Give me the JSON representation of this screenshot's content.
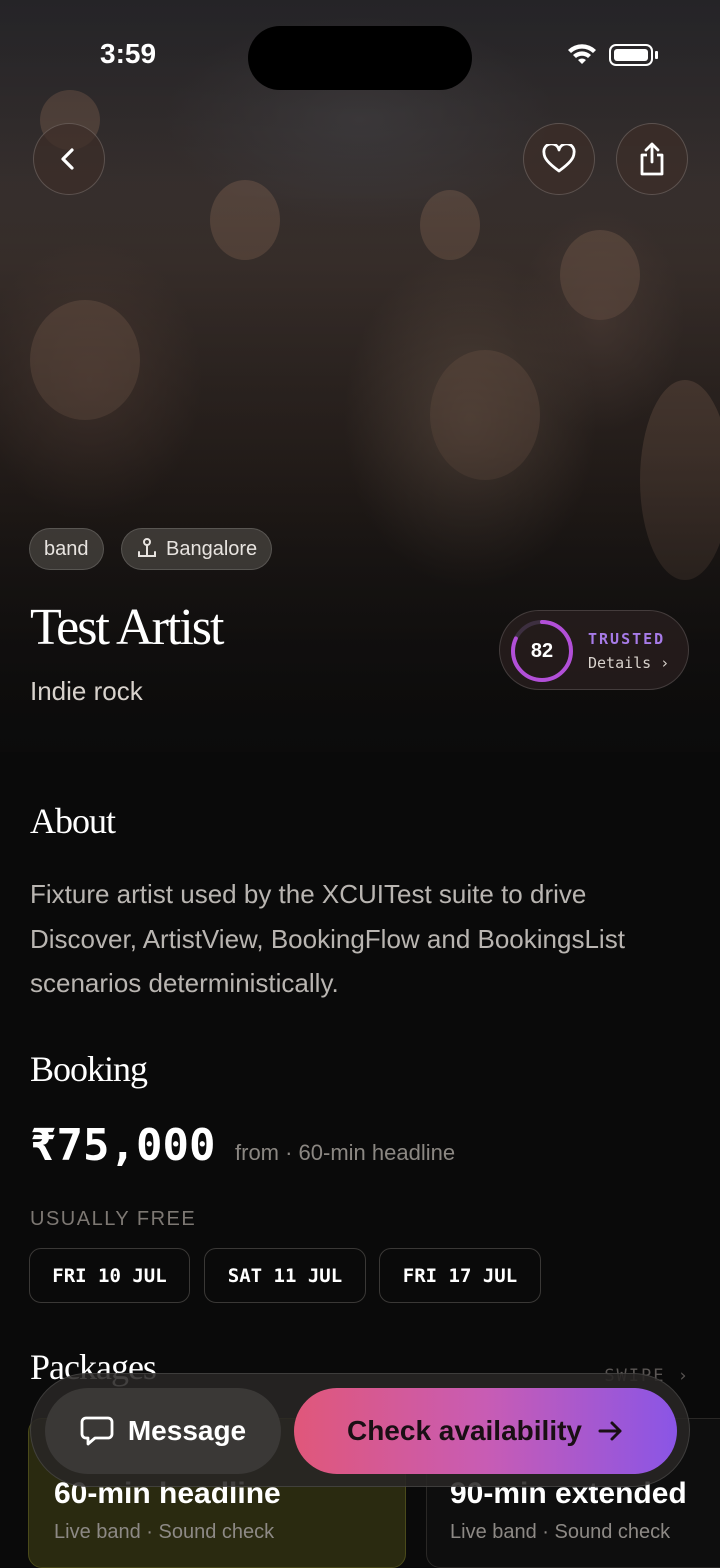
{
  "status_bar": {
    "time": "3:59"
  },
  "hero": {
    "tags": [
      {
        "label": "band"
      },
      {
        "label": "Bangalore",
        "icon": "location-pin-icon"
      }
    ],
    "artist_name": "Test Artist",
    "genre": "Indie rock",
    "trust": {
      "score": "82",
      "score_fraction": 0.82,
      "label": "TRUSTED",
      "details": "Details"
    }
  },
  "about": {
    "heading": "About",
    "text": "Fixture artist used by the XCUITest suite to drive Discover, ArtistView, BookingFlow and BookingsList scenarios deterministically."
  },
  "booking": {
    "heading": "Booking",
    "price": "₹75,000",
    "price_sub": "from · 60-min headline",
    "usually_free_label": "USUALLY FREE",
    "dates": [
      "FRI 10 JUL",
      "SAT 11 JUL",
      "FRI 17 JUL"
    ]
  },
  "packages": {
    "heading": "Packages",
    "swipe_label": "SWIPE",
    "items": [
      {
        "title": "60-min headline",
        "subtitle": "Live band · Sound check"
      },
      {
        "title": "90-min extended",
        "subtitle": "Live band · Sound check"
      }
    ]
  },
  "bottom_bar": {
    "message_label": "Message",
    "availability_label": "Check availability"
  },
  "colors": {
    "accent_purple": "#a77be8",
    "gradient_start": "#e0577a",
    "gradient_end": "#8a55e6",
    "background": "#0a0a0a"
  }
}
